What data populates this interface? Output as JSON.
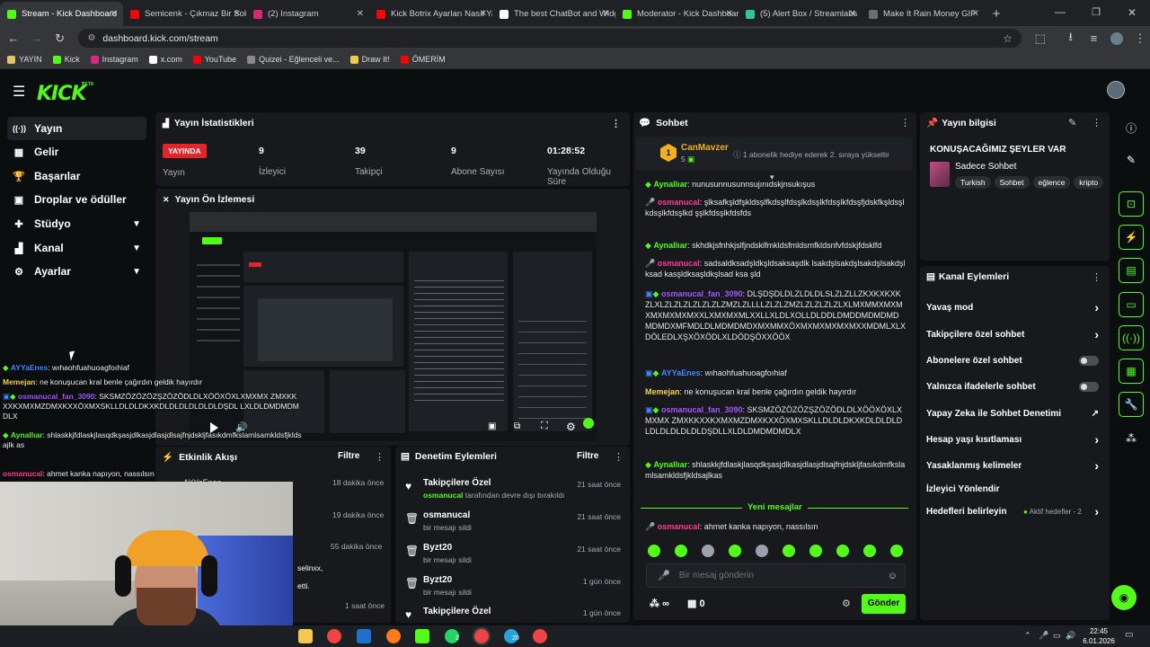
{
  "browser": {
    "tabs": [
      {
        "title": "Stream - Kick Dashboard",
        "color": "#53fc18",
        "active": true
      },
      {
        "title": "Semicenk - Çıkmaz Bir Sokak",
        "color": "#ff0000"
      },
      {
        "title": "(2) Instagram",
        "color": "#d62976"
      },
      {
        "title": "Kick Botrix Ayarları Nasıl Yapılır",
        "color": "#ff0000"
      },
      {
        "title": "The best ChatBot and Widgets",
        "color": "#ffffff"
      },
      {
        "title": "Moderator - Kick Dashboard",
        "color": "#53fc18"
      },
      {
        "title": "(5) Alert Box / Streamlabs",
        "color": "#31c3a2"
      },
      {
        "title": "Make It Rain Money GIF",
        "color": "#6e6e6e"
      }
    ],
    "new_tab": "+",
    "url": "dashboard.kick.com/stream",
    "bookmarks": [
      {
        "label": "YAYIN",
        "color": "#e8c26b"
      },
      {
        "label": "Kick",
        "color": "#53fc18"
      },
      {
        "label": "Instagram",
        "color": "#d62976"
      },
      {
        "label": "x.com",
        "color": "#ffffff"
      },
      {
        "label": "YouTube",
        "color": "#ff0000"
      },
      {
        "label": "Quizei - Eğlenceli ve...",
        "color": "#8a8a8a"
      },
      {
        "label": "Draw It!",
        "color": "#f2c94c"
      },
      {
        "label": "ÖMERİM",
        "color": "#ff0000"
      }
    ]
  },
  "app": {
    "logo": "KICK",
    "logo_beta": "BETA",
    "accent": "#53fc18"
  },
  "sidebar": [
    {
      "label": "Yayın",
      "icon": "((·))",
      "active": true
    },
    {
      "label": "Gelir",
      "icon": "▦"
    },
    {
      "label": "Başarılar",
      "icon": "🏆"
    },
    {
      "label": "Droplar ve ödüller",
      "icon": "▣"
    },
    {
      "label": "Stüdyo",
      "icon": "✚",
      "chevron": true
    },
    {
      "label": "Kanal",
      "icon": "▟",
      "chevron": true
    },
    {
      "label": "Ayarlar",
      "icon": "⚙",
      "chevron": true
    }
  ],
  "stats": {
    "title": "Yayın İstatistikleri",
    "live_badge": "YAYINDA",
    "live_label": "Yayın",
    "items": [
      {
        "value": "9",
        "label": "İzleyici"
      },
      {
        "value": "39",
        "label": "Takipçi"
      },
      {
        "value": "9",
        "label": "Abone Sayısı"
      },
      {
        "value": "01:28:52",
        "label": "Yayında Olduğu Süre"
      }
    ]
  },
  "preview": {
    "title": "Yayın Ön İzlemesi"
  },
  "overlay_chat": [
    {
      "user": "AYYaEnes",
      "color": "#3d8bff",
      "text": "wıhaohfuahuoagfoıhiaf"
    },
    {
      "user": "Memejan",
      "color": "#f2d44a",
      "text": "ne konuşucan kral benle çağırdın geldik hayırdır"
    },
    {
      "user": "osmanucal_fan_3090",
      "color": "#a257ff",
      "text": "SKSMZÖZÖZÖZŞZÖZÖDLDLXÖÖXÖXLXMXMX ZMXKKXXKXMXMZDMXKXXÖXMXSKLLDLDLDKXKDLDLDLDLDLDLDŞDL LXLDLDMDMDMDLX"
    },
    {
      "user": "Aynallıar",
      "color": "#53fc18",
      "text": "shlaskkjfdlaskjlasqdkşasjdlkasjdlasjdlsajfnjdskljfasıkdmfkslamlsamkldsfjkldsajlk as"
    },
    {
      "user": "osmanucal",
      "color": "#ff3b9a",
      "text": "ahmet kanka napıyon, nassılsın"
    }
  ],
  "activity": {
    "title": "Etkinlik Akışı",
    "filter": "Filtre",
    "peek_user": "AYYaEnes",
    "rows": [
      {
        "time": "18 dakika önce"
      },
      {
        "time": "19 dakika önce"
      },
      {
        "time": "55 dakika önce",
        "text": "selinxx,"
      },
      {
        "time": "",
        "text": "etti."
      },
      {
        "time": "1 saat önce"
      }
    ]
  },
  "moderation": {
    "title": "Denetim Eylemleri",
    "filter": "Filtre",
    "rows": [
      {
        "icon": "♥",
        "title": "Takipçilere Özel",
        "sub_user": "osmanucal",
        "sub": "tarafından devre dışı bırakıldı",
        "time": "21 saat önce"
      },
      {
        "icon": "🗑",
        "title": "osmanucal",
        "sub": "bir mesajı sildi",
        "time": "21 saat önce"
      },
      {
        "icon": "🗑",
        "title": "Byzt20",
        "sub": "bir mesajı sildi",
        "time": "21 saat önce"
      },
      {
        "icon": "🗑",
        "title": "Byzt20",
        "sub": "bir mesajı sildi",
        "time": "1 gün önce"
      },
      {
        "icon": "♥",
        "title": "Takipçilere Özel",
        "sub": "",
        "time": "1 gün önce"
      }
    ]
  },
  "chat": {
    "title": "Sohbet",
    "pinned": {
      "user": "CanMavzer",
      "count": "5",
      "text": "1 abonelik hediye ederek 2. sıraya yükseltir"
    },
    "messages": [
      {
        "user": "Aynallıar",
        "color": "#53fc18",
        "text": "nunusunnusunnsujınıdskjnsukışus"
      },
      {
        "user": "osmanucal",
        "color": "#ff3b9a",
        "text": "şlksafkşldfşkldsşlfkdsşlfdsşlkdsşlkfdsşlkfdsşfjdskfkşldsşlkdsşlkfdsşlkd şşlkfdsşlkfdsfds"
      },
      {
        "user": "Aynallıar",
        "color": "#53fc18",
        "text": "skhdkjsfnhkjslfjndsklfmkldsfmldsmfkldsnfvfdskjfdsklfd"
      },
      {
        "user": "osmanucal",
        "color": "#ff3b9a",
        "text": "sadsaldksadşldkşldsaksaşdlk lsakdşlsakdşlsakdşlsakdşl ksad kasşldksaşldkşlsad ksa şld"
      },
      {
        "user": "osmanucal_fan_3090",
        "color": "#a257ff",
        "text": "DLŞDŞDLDLZLDLDLSLZLZLLZKXKXKXKZLXLZLZLZLZLZLZLZMZLZLLLLZLZLZMZLZLZLZLZLXLMXMMXMXMXMXMXMXMXXLXMXMXMLXXLLXLDLXOLLDLDDLDMDDMDMDMDMDMDXMFMDLDLMDMDMDXMXMMXÖXMXMXMXMXMXXMDMLXLXDÖLEDLXŞXÖXÖDLXLDÖDŞÖXXÖÖX"
      },
      {
        "user": "AYYaEnes",
        "color": "#3d8bff",
        "text": "wıhaohfuahuoagfoıhiaf"
      },
      {
        "user": "Memejan",
        "color": "#f2d44a",
        "text": "ne konuşucan kral benle çağırdın geldik hayırdır"
      },
      {
        "user": "osmanucal_fan_3090",
        "color": "#a257ff",
        "text": "SKSMZÖZÖZÖZŞZÖZÖDLDLXÖÖXÖXLXMXMX ZMXKKXXKXMXMZDMXKXXÖXMXSKLLDLDLDKXKDLDLDLDLDLDLDLDLDLDŞDLLXLDLDMDMDMDLX"
      },
      {
        "user": "Aynallıar",
        "color": "#53fc18",
        "text": "shlaskkjfdlaskjlasqdkşasjdlkasjdlasjdlsajfnjdskljfasıkdmfkslamlsamkldsfjkldsajlkas"
      }
    ],
    "new_messages": "Yeni mesajlar",
    "last": {
      "user": "osmanucal",
      "color": "#ff3b9a",
      "text": "ahmet kanka napıyon, nassılsın"
    },
    "input_placeholder": "Bir mesaj gönderin",
    "points": "∞",
    "gift_count": "0",
    "send": "Gönder"
  },
  "stream_info": {
    "title": "Yayın bilgisi",
    "stream_title": "KONUŞACAĞIMIZ ŞEYLER VAR",
    "category": "Sadece Sohbet",
    "tags": [
      "Turkish",
      "Sohbet",
      "eğlence",
      "kripto"
    ]
  },
  "channel_actions": {
    "title": "Kanal Eylemleri",
    "items": [
      {
        "label": "Yavaş mod",
        "control": "chevron"
      },
      {
        "label": "Takipçilere özel sohbet",
        "control": "chevron"
      },
      {
        "label": "Abonelere özel sohbet",
        "control": "toggle"
      },
      {
        "label": "Yalnızca ifadelerle sohbet",
        "control": "toggle"
      },
      {
        "label": "Yapay Zeka ile Sohbet Denetimi",
        "control": "external"
      },
      {
        "label": "Hesap yaşı kısıtlaması",
        "control": "chevron"
      },
      {
        "label": "Yasaklanmış kelimeler",
        "control": "chevron"
      },
      {
        "label": "İzleyici Yönlendir",
        "control": "none"
      },
      {
        "label": "Hedefleri belirleyin",
        "control": "chevron",
        "badge": "Aktif hedefler - 2"
      }
    ]
  },
  "taskbar": {
    "time": "22:45",
    "date": "6.01.2026",
    "badges": [
      "2",
      "20"
    ]
  }
}
